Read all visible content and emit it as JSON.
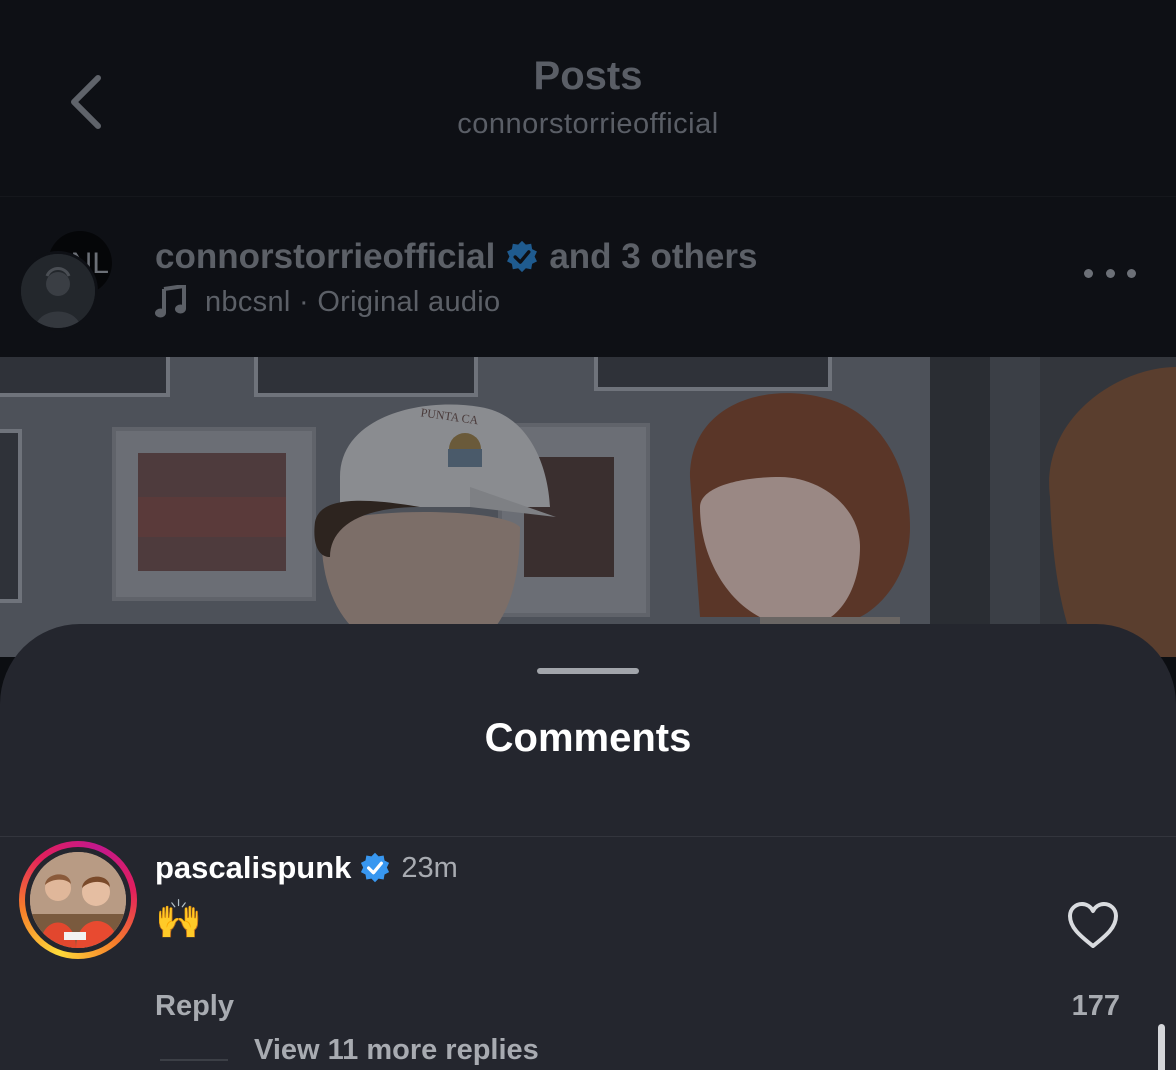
{
  "nav": {
    "title": "Posts",
    "subtitle": "connorstorrieofficial"
  },
  "post": {
    "back_avatar_text": "NL",
    "author": "connorstorrieofficial",
    "collaborators": "and 3 others",
    "audio_artist": "nbcsnl",
    "audio_separator": "·",
    "audio_label": "Original audio",
    "video_hat_text": "PUNTA CA"
  },
  "comments_sheet": {
    "title": "Comments",
    "comments": [
      {
        "username": "pascalispunk",
        "verified": true,
        "time": "23m",
        "text": "🙌",
        "reply_label": "Reply",
        "likes": "177",
        "view_replies": "View 11 more replies"
      }
    ]
  },
  "colors": {
    "verified_badge": "#3897f0",
    "sheet_bg": "#24262e",
    "dimmed_bg": "#0e1015"
  },
  "icons": [
    "back-chevron-icon",
    "verified-badge-icon",
    "music-note-icon",
    "more-options-icon",
    "heart-icon"
  ]
}
